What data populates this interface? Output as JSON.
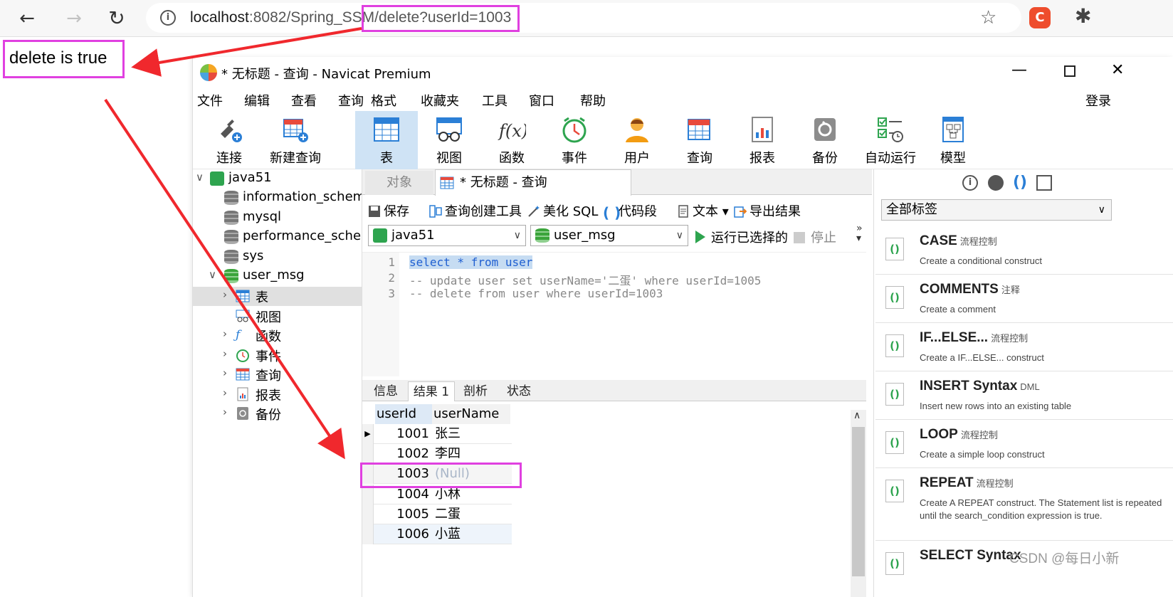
{
  "browser": {
    "url_host": "localhost",
    "url_rest": ":8082/Spring_SSM/",
    "url_highlight": "delete?userId=1003",
    "extension_letter": "C"
  },
  "page": {
    "output_text": "delete is true"
  },
  "navicat": {
    "title": "* 无标题 - 查询 - Navicat Premium",
    "menu": [
      "文件",
      "编辑",
      "查看",
      "查询",
      "格式",
      "收藏夹",
      "工具",
      "窗口",
      "帮助"
    ],
    "login": "登录",
    "toolbar": [
      {
        "label": "连接",
        "icon": "plug-icon"
      },
      {
        "label": "新建查询",
        "icon": "new-query-icon"
      },
      {
        "label": "表",
        "icon": "table-icon"
      },
      {
        "label": "视图",
        "icon": "view-icon"
      },
      {
        "label": "函数",
        "icon": "function-icon"
      },
      {
        "label": "事件",
        "icon": "clock-icon"
      },
      {
        "label": "用户",
        "icon": "user-icon"
      },
      {
        "label": "查询",
        "icon": "query-icon"
      },
      {
        "label": "报表",
        "icon": "report-icon"
      },
      {
        "label": "备份",
        "icon": "backup-icon"
      },
      {
        "label": "自动运行",
        "icon": "automation-icon"
      },
      {
        "label": "模型",
        "icon": "model-icon"
      }
    ],
    "function_glyph": "f(x)",
    "tree": {
      "connection": "java51",
      "databases": [
        "information_schema",
        "mysql",
        "performance_schema",
        "sys",
        "user_msg"
      ],
      "items": [
        "表",
        "视图",
        "函数",
        "事件",
        "查询",
        "报表",
        "备份"
      ]
    },
    "tabs": {
      "objects": "对象",
      "query": "* 无标题 - 查询"
    },
    "query_toolbar": {
      "save": "保存",
      "builder": "查询创建工具",
      "beautify": "美化 SQL",
      "snippet": "代码段",
      "text": "文本",
      "export": "导出结果"
    },
    "selectors": {
      "connection": "java51",
      "database": "user_msg"
    },
    "run_selected": "运行已选择的",
    "stop": "停止",
    "editor": {
      "line_numbers": [
        "1",
        "2",
        "3"
      ],
      "lines": [
        "select * from user",
        "-- update user set userName='二蛋' where userId=1005",
        "-- delete from user where userId=1003"
      ]
    },
    "result_tabs": [
      "信息",
      "结果 1",
      "剖析",
      "状态"
    ],
    "grid": {
      "columns": [
        "userId",
        "userName"
      ],
      "rows": [
        {
          "userId": "1001",
          "userName": "张三"
        },
        {
          "userId": "1002",
          "userName": "李四"
        },
        {
          "userId": "1003",
          "userName": "(Null)"
        },
        {
          "userId": "1004",
          "userName": "小林"
        },
        {
          "userId": "1005",
          "userName": "二蛋"
        },
        {
          "userId": "1006",
          "userName": "小蓝"
        }
      ]
    },
    "snippets": {
      "tag_filter": "全部标签",
      "items": [
        {
          "name": "CASE",
          "tag": "流程控制",
          "desc": "Create a conditional construct"
        },
        {
          "name": "COMMENTS",
          "tag": "注释",
          "desc": "Create a comment"
        },
        {
          "name": "IF...ELSE...",
          "tag": "流程控制",
          "desc": "Create a IF...ELSE... construct"
        },
        {
          "name": "INSERT Syntax",
          "tag": "DML",
          "desc": "Insert new rows into an existing table"
        },
        {
          "name": "LOOP",
          "tag": "流程控制",
          "desc": "Create a simple loop construct"
        },
        {
          "name": "REPEAT",
          "tag": "流程控制",
          "desc": "Create A REPEAT construct. The Statement list is repeated until the search_condition expression is true."
        },
        {
          "name": "SELECT Syntax",
          "tag": "",
          "desc": ""
        }
      ]
    }
  },
  "watermark": "CSDN @每日小新",
  "colors": {
    "highlight": "#e040e0",
    "arrow": "#f0282d",
    "selection": "#cfe3f5"
  }
}
